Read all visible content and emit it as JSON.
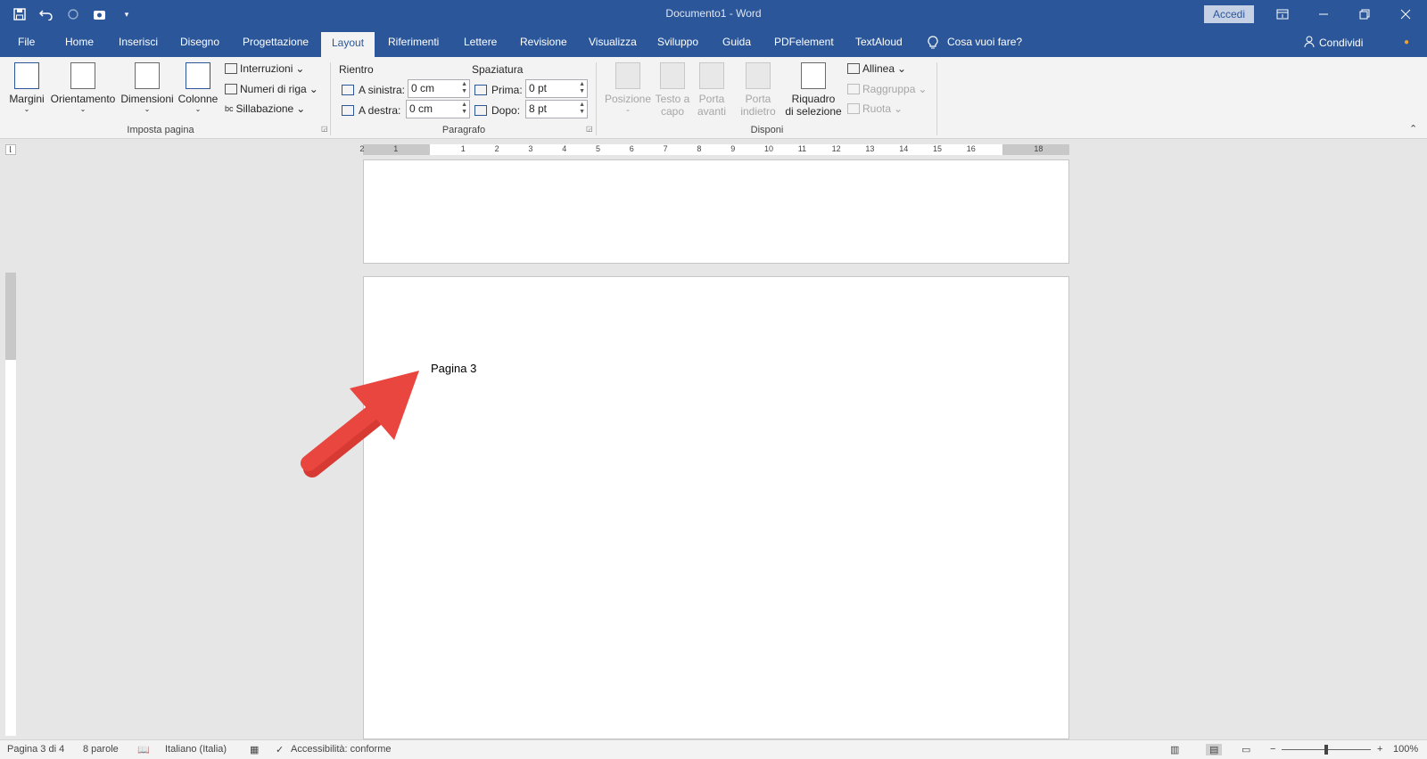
{
  "app": {
    "title": "Documento1  -  Word",
    "signin": "Accedi"
  },
  "tabs": [
    "File",
    "Home",
    "Inserisci",
    "Disegno",
    "Progettazione",
    "Layout",
    "Riferimenti",
    "Lettere",
    "Revisione",
    "Visualizza",
    "Sviluppo",
    "Guida",
    "PDFelement",
    "TextAloud"
  ],
  "active_tab": "Layout",
  "tell_me": "Cosa vuoi fare?",
  "share": "Condividi",
  "ribbon": {
    "imposta": {
      "label": "Imposta pagina",
      "margini": "Margini",
      "orientamento": "Orientamento",
      "dimensioni": "Dimensioni",
      "colonne": "Colonne",
      "interruzioni": "Interruzioni",
      "numeri": "Numeri di riga",
      "sillabazione": "Sillabazione"
    },
    "paragrafo": {
      "label": "Paragrafo",
      "rientro": "Rientro",
      "spaziatura": "Spaziatura",
      "sinistra_label": "A sinistra:",
      "sinistra_value": "0 cm",
      "destra_label": "A destra:",
      "destra_value": "0 cm",
      "prima_label": "Prima:",
      "prima_value": "0 pt",
      "dopo_label": "Dopo:",
      "dopo_value": "8 pt"
    },
    "disponi": {
      "label": "Disponi",
      "posizione": "Posizione",
      "testo_a": "Testo a",
      "capo": "capo",
      "porta": "Porta",
      "avanti": "avanti",
      "indietro": "indietro",
      "riquadro": "Riquadro",
      "di_selezione": "di selezione",
      "allinea": "Allinea",
      "raggruppa": "Raggruppa",
      "ruota": "Ruota"
    }
  },
  "ruler_numbers": [
    "2",
    "1",
    "1",
    "2",
    "3",
    "4",
    "5",
    "6",
    "7",
    "8",
    "9",
    "10",
    "11",
    "12",
    "13",
    "14",
    "15",
    "16",
    "18"
  ],
  "document": {
    "text": "Pagina 3"
  },
  "status": {
    "page": "Pagina 3 di 4",
    "words": "8 parole",
    "language": "Italiano (Italia)",
    "accessibility": "Accessibilità: conforme",
    "zoom": "100%"
  },
  "colors": {
    "brand": "#2b579a",
    "arrow": "#e8463f"
  },
  "zoom_level": 0.5
}
